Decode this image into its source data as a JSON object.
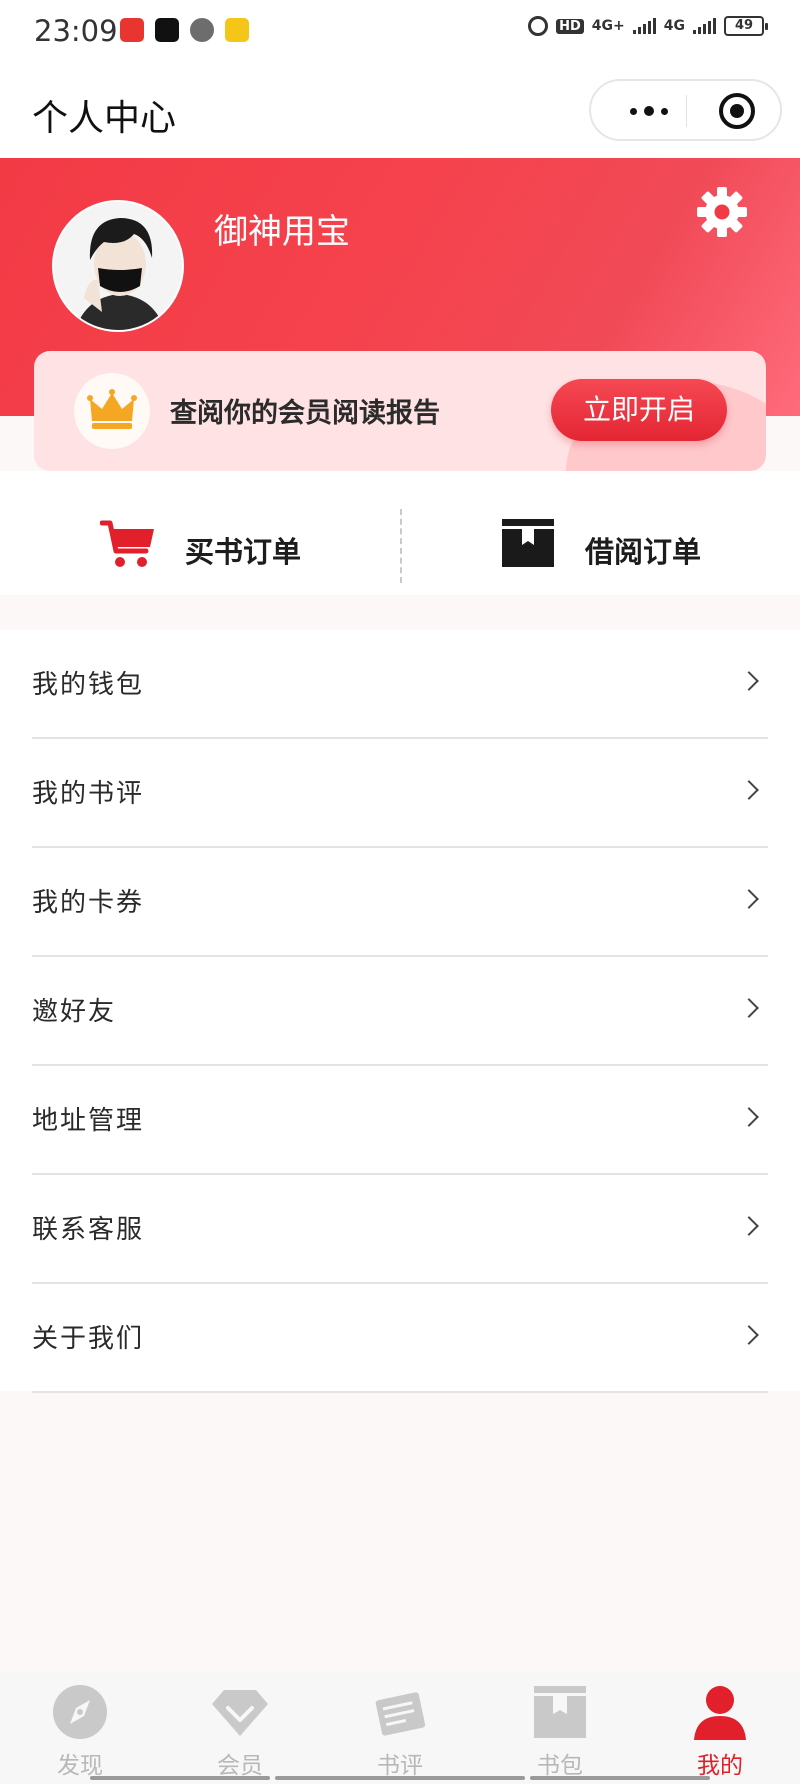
{
  "status_bar": {
    "time": "23:09",
    "battery": "49",
    "hd_label": "HD",
    "net1": "4G+",
    "net2": "4G"
  },
  "nav": {
    "title": "个人中心"
  },
  "profile": {
    "username": "御神用宝"
  },
  "member_card": {
    "text": "查阅你的会员阅读报告",
    "button": "立即开启"
  },
  "orders": [
    {
      "label": "买书订单",
      "icon": "shopping-cart-icon"
    },
    {
      "label": "借阅订单",
      "icon": "book-box-icon"
    }
  ],
  "menu": [
    {
      "label": "我的钱包"
    },
    {
      "label": "我的书评"
    },
    {
      "label": "我的卡券"
    },
    {
      "label": "邀好友"
    },
    {
      "label": "地址管理"
    },
    {
      "label": "联系客服"
    },
    {
      "label": "关于我们"
    }
  ],
  "tabs": [
    {
      "label": "发现",
      "icon": "compass-icon"
    },
    {
      "label": "会员",
      "icon": "diamond-icon"
    },
    {
      "label": "书评",
      "icon": "review-icon"
    },
    {
      "label": "书包",
      "icon": "book-bag-icon"
    },
    {
      "label": "我的",
      "icon": "user-icon",
      "active": true
    }
  ],
  "colors": {
    "brand_red": "#f23a45",
    "active_tab": "#e1202b",
    "crown_gold": "#f5a623"
  }
}
